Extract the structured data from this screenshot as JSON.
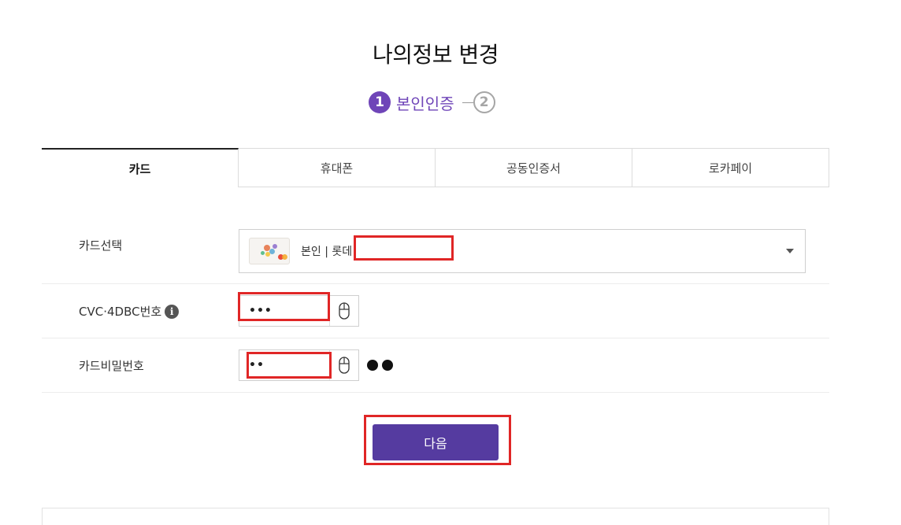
{
  "page": {
    "title": "나의정보 변경"
  },
  "steps": [
    {
      "number": "1",
      "label": "본인인증",
      "active": true
    },
    {
      "number": "2",
      "label": "",
      "active": false
    }
  ],
  "tabs": [
    {
      "label": "카드",
      "active": true
    },
    {
      "label": "휴대폰",
      "active": false
    },
    {
      "label": "공동인증서",
      "active": false
    },
    {
      "label": "로카페이",
      "active": false
    }
  ],
  "form": {
    "card_select": {
      "label": "카드선택",
      "value": "본인 | 롯데"
    },
    "cvc": {
      "label": "CVC·4DBC번호",
      "info_icon": "info-icon",
      "value": "•••"
    },
    "card_password": {
      "label": "카드비밀번호",
      "value": "••",
      "suffix_dots": 2
    }
  },
  "actions": {
    "next_label": "다음"
  },
  "colors": {
    "accent": "#6f45b8",
    "button": "#553ba0",
    "highlight": "#e02626"
  }
}
